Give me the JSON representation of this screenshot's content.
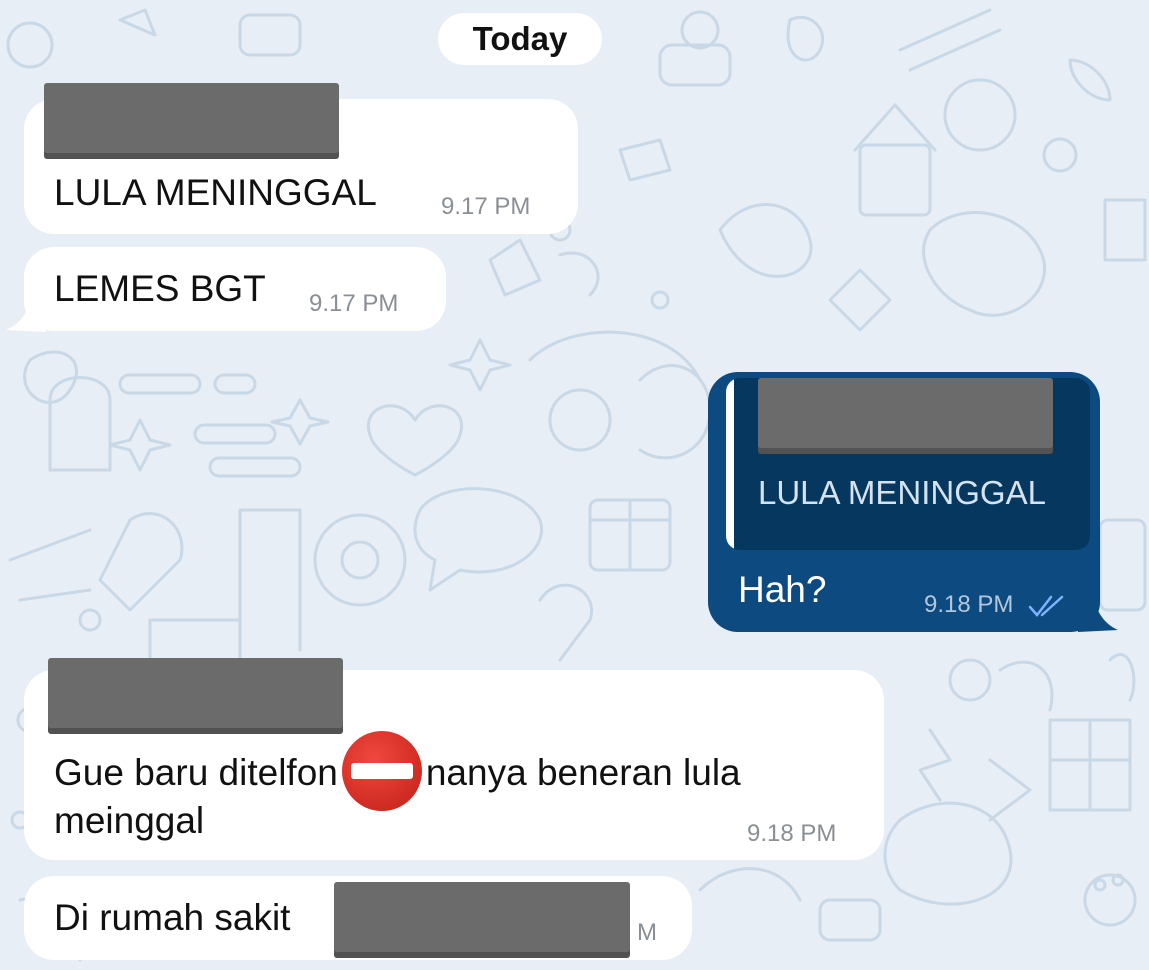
{
  "date_separator": "Today",
  "messages": [
    {
      "text": "LULA MENINGGAL",
      "time": "9.17 PM"
    },
    {
      "text": "LEMES BGT",
      "time": "9.17 PM"
    },
    {
      "quote_text": "LULA MENINGGAL",
      "text": "Hah?",
      "time": "9.18 PM",
      "status": "double-check-icon"
    },
    {
      "text_before": "Gue baru ditelfon",
      "emoji": "no-entry-icon",
      "text_after": "nanya beneran lula",
      "text_line2": "meinggal",
      "time": "9.18 PM"
    },
    {
      "text": "Di rumah sakit",
      "time_fragment": "M"
    }
  ],
  "colors": {
    "background": "#e7eef6",
    "incoming_bubble": "#ffffff",
    "outgoing_bubble": "#0c4a80",
    "quote_block": "#06385f",
    "redaction": "#6b6b6b"
  }
}
